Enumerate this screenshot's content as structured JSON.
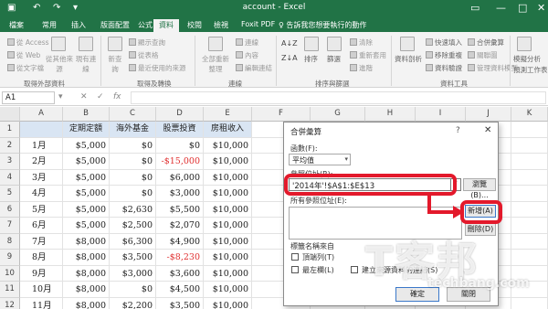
{
  "app": {
    "window_title": "account - Excel",
    "accent_color": "#217346"
  },
  "quick_access": {
    "save_icon": "save-icon",
    "undo_icon": "undo-icon",
    "redo_icon": "redo-icon"
  },
  "tabs": [
    {
      "label": "檔案"
    },
    {
      "label": "常用"
    },
    {
      "label": "插入"
    },
    {
      "label": "版面配置"
    },
    {
      "label": "公式"
    },
    {
      "label": "資料",
      "active": true
    },
    {
      "label": "校閱"
    },
    {
      "label": "檢視"
    },
    {
      "label": "Foxit PDF"
    }
  ],
  "tell_me": "♀ 告訴我您想要執行的動作",
  "ribbon": {
    "external": {
      "items": [
        "從 Access",
        "從 Web",
        "從文字檔"
      ],
      "other_sources": "從其他來源",
      "existing_conn": "現有連線",
      "label": "取得外部資料"
    },
    "transform": {
      "new_query": "新查詢",
      "items": [
        "顯示查詢",
        "從表格",
        "最近使用的來源"
      ],
      "label": "取得及轉換"
    },
    "connections": {
      "refresh_all": "全部重新整理",
      "items": [
        "連線",
        "內容",
        "編輯連結"
      ],
      "label": "連線"
    },
    "sort_filter": {
      "sort": "排序",
      "filter": "篩選",
      "items": [
        "清除",
        "重新套用",
        "進階"
      ],
      "label": "排序與篩選"
    },
    "data_tools": {
      "text_to_cols": "資料剖析",
      "items": [
        "快速填入",
        "移除重複",
        "資料驗證"
      ],
      "items2": [
        "合併彙算",
        "關聯圖",
        "管理資料模型"
      ],
      "label": "資料工具"
    },
    "forecast": {
      "whatif": "模擬分析",
      "sheet": "預測工作表",
      "label": "預測"
    }
  },
  "formula_bar": {
    "name_box": "A1",
    "cancel": "✕",
    "enter": "✓",
    "fx": "fx",
    "content": ""
  },
  "sheet": {
    "columns": [
      "A",
      "B",
      "C",
      "D",
      "E",
      "F",
      "G",
      "H",
      "I",
      "J",
      "K"
    ],
    "header_row": [
      "",
      "定期定額",
      "海外基金",
      "股票投資",
      "房租收入"
    ],
    "rows": [
      [
        "1月",
        "$5,000",
        "$0",
        "$0",
        "$10,000"
      ],
      [
        "2月",
        "$5,000",
        "$0",
        "-$15,000",
        "$10,000"
      ],
      [
        "3月",
        "$5,000",
        "$0",
        "$6,000",
        "$10,000"
      ],
      [
        "4月",
        "$5,000",
        "$0",
        "$3,000",
        "$10,000"
      ],
      [
        "5月",
        "$5,000",
        "$2,630",
        "$5,500",
        "$10,000"
      ],
      [
        "6月",
        "$5,000",
        "$2,500",
        "$2,070",
        "$10,000"
      ],
      [
        "7月",
        "$8,000",
        "$6,300",
        "$4,900",
        "$10,000"
      ],
      [
        "8月",
        "$8,000",
        "$3,500",
        "-$8,230",
        "$10,000"
      ],
      [
        "9月",
        "$8,000",
        "$3,000",
        "$3,600",
        "$10,000"
      ],
      [
        "10月",
        "$8,000",
        "$0",
        "$4,500",
        "$10,000"
      ],
      [
        "11月",
        "$8,000",
        "$2,200",
        "$3,500",
        "$10,000"
      ]
    ],
    "row_numbers": [
      "1",
      "2",
      "3",
      "4",
      "5",
      "6",
      "7",
      "8",
      "9",
      "10",
      "11",
      "12"
    ],
    "negative_color": "#e03030",
    "header_fill": "#d9e5f3"
  },
  "dialog": {
    "title": "合併彙算",
    "help": "?",
    "close": "✕",
    "function_label": "函數(F):",
    "function_value": "平均值",
    "reference_label": "參照位址(R):",
    "reference_value": "'2014年'!$A$1:$E$13",
    "browse": "瀏覽(B)...",
    "all_refs_label": "所有參照位址(E):",
    "add": "新增(A)",
    "delete": "刪除(D)",
    "labels_group": "標籤名稱來自",
    "top_row": "頂端列(T)",
    "left_col": "最左欄(L)",
    "link": "建立來源資料的連結(S)",
    "ok": "確定",
    "close_btn": "關閉"
  },
  "annotation_color": "#e3192b",
  "watermark": {
    "big": "T客邦",
    "small": "techbang.com"
  }
}
